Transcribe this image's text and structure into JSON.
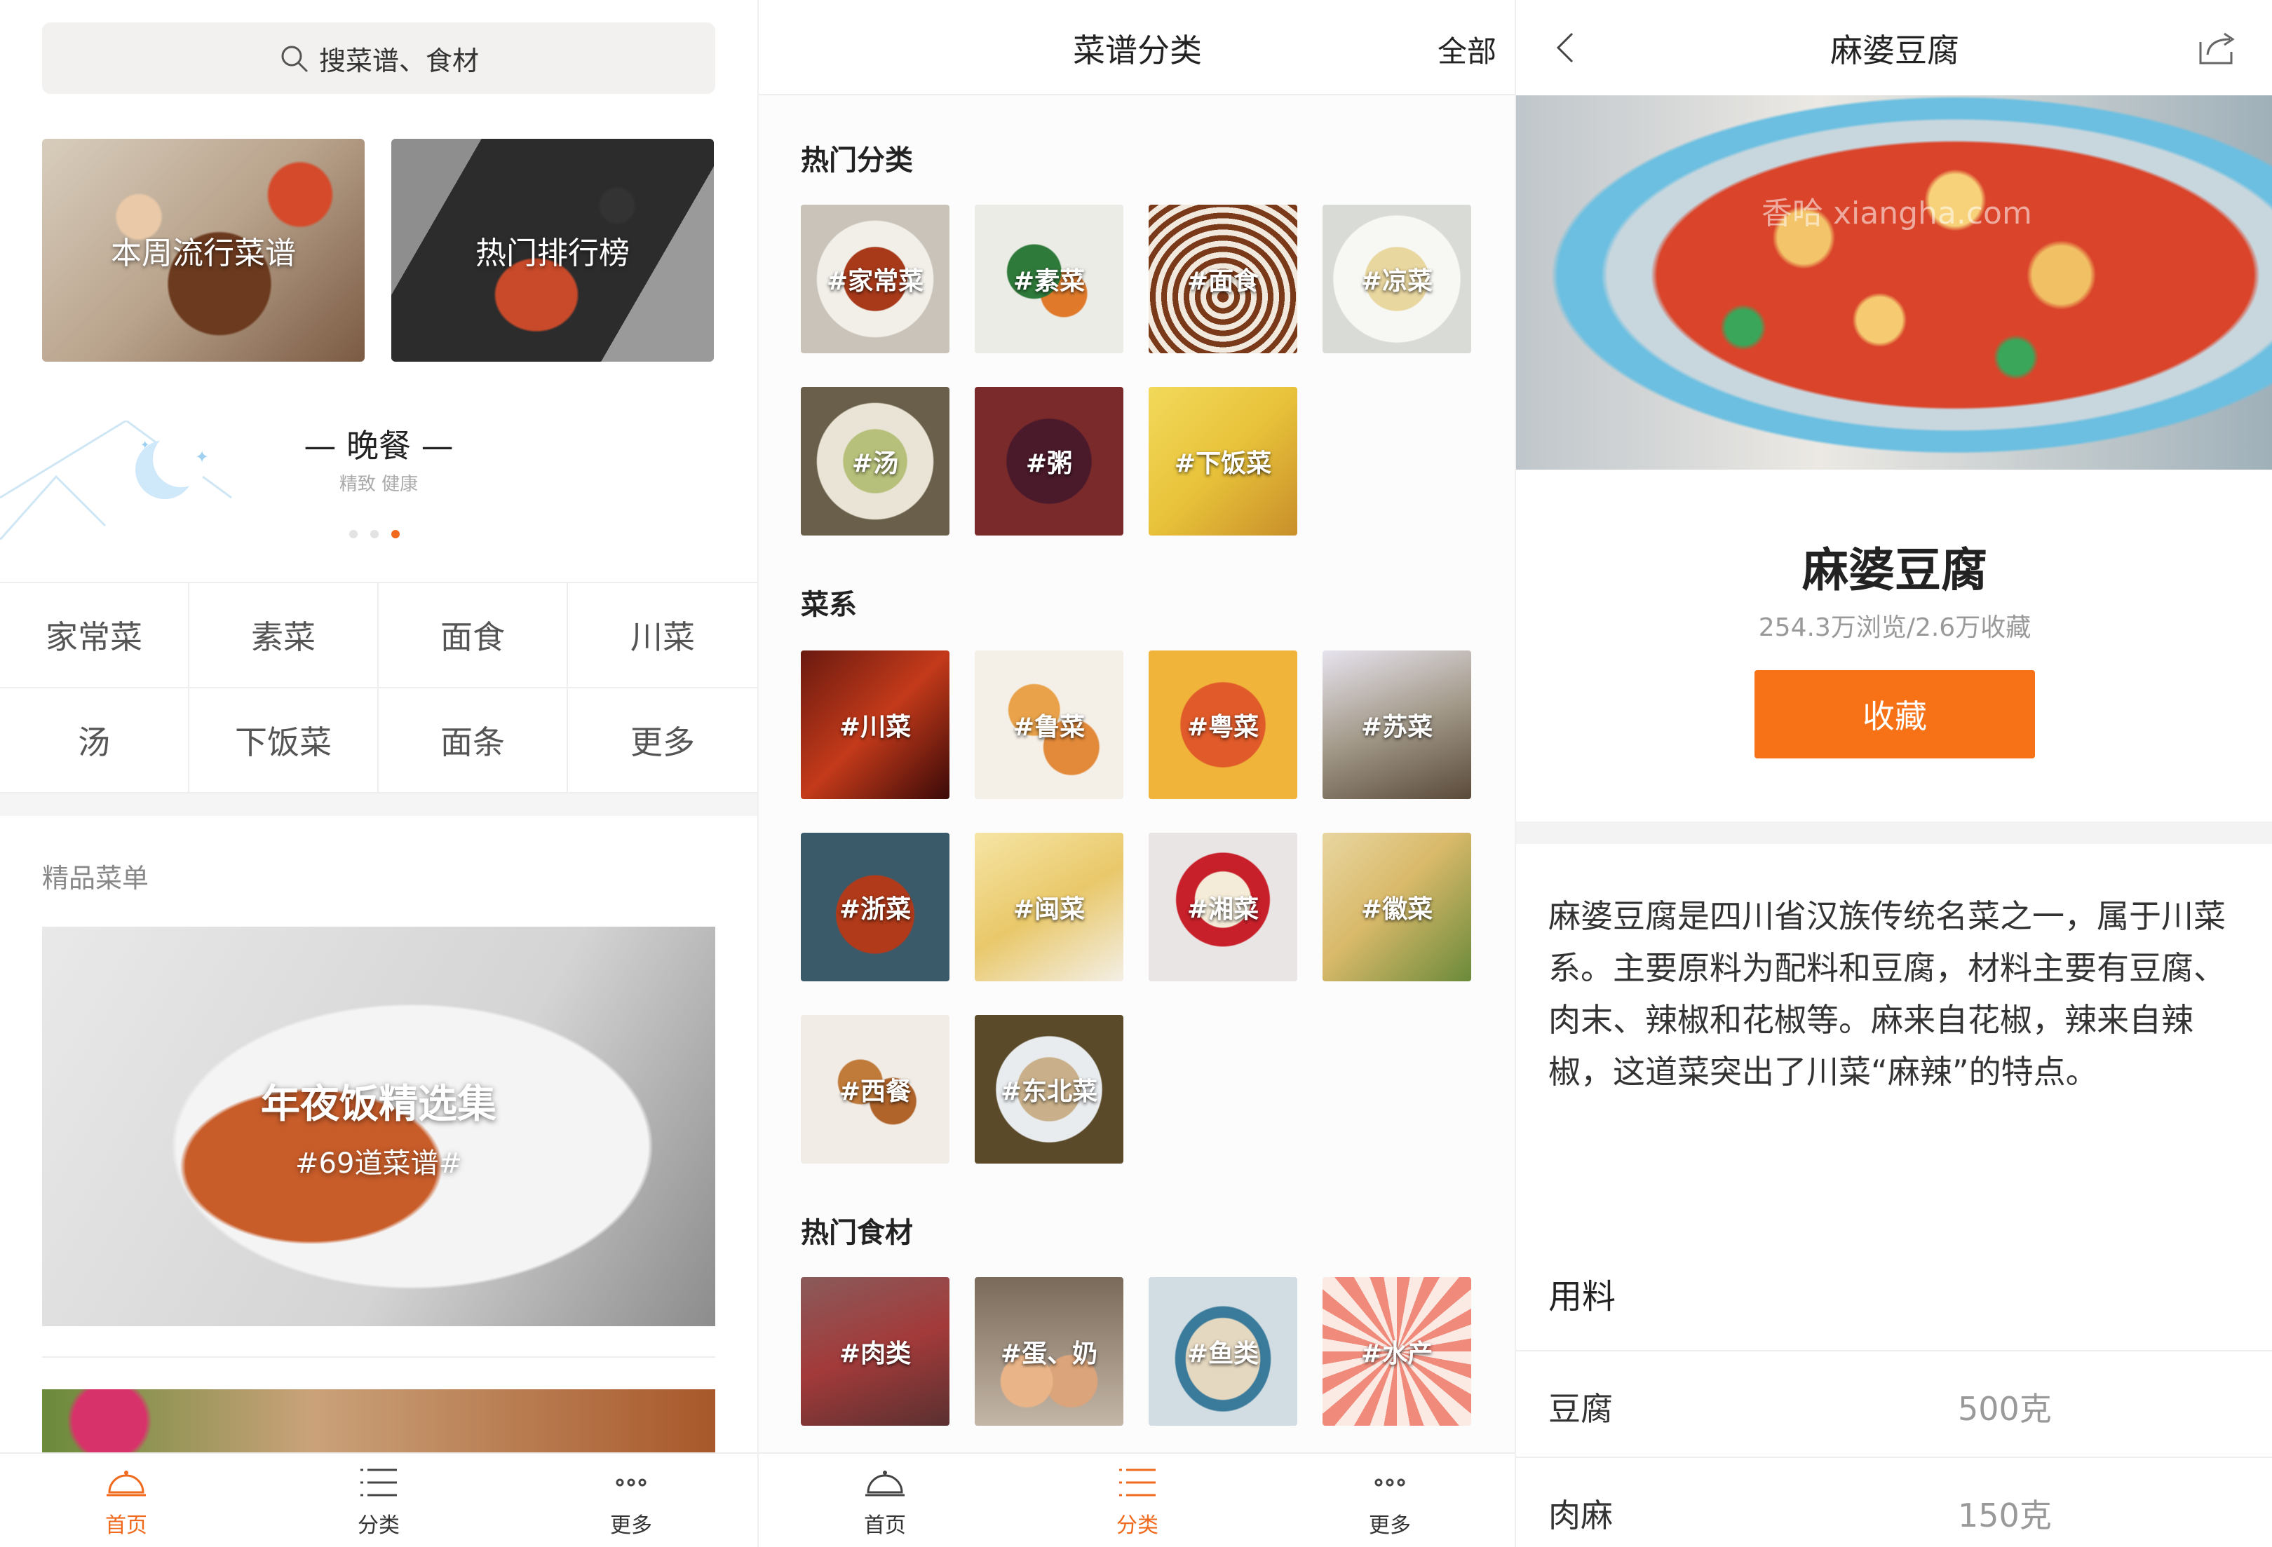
{
  "home": {
    "search_placeholder": "搜菜谱、食材",
    "banners": [
      "本周流行菜谱",
      "热门排行榜"
    ],
    "meal": {
      "title": "— 晚餐 —",
      "subtitle": "精致 健康",
      "page_index": 3,
      "page_count": 3
    },
    "categories": [
      "家常菜",
      "素菜",
      "面食",
      "川菜",
      "汤",
      "下饭菜",
      "面条",
      "更多"
    ],
    "section_label": "精品菜单",
    "feature": {
      "title": "年夜饭精选集",
      "subtitle": "#69道菜谱#"
    },
    "tabs": [
      "首页",
      "分类",
      "更多"
    ],
    "active_tab": "首页"
  },
  "category": {
    "title": "菜谱分类",
    "all_label": "全部",
    "groups": [
      {
        "title": "热门分类",
        "items": [
          "#家常菜",
          "#素菜",
          "#面食",
          "#凉菜",
          "#汤",
          "#粥",
          "#下饭菜"
        ]
      },
      {
        "title": "菜系",
        "items": [
          "#川菜",
          "#鲁菜",
          "#粤菜",
          "#苏菜",
          "#浙菜",
          "#闽菜",
          "#湘菜",
          "#徽菜",
          "#西餐",
          "#东北菜"
        ]
      },
      {
        "title": "热门食材",
        "items": [
          "#肉类",
          "#蛋、奶",
          "#鱼类",
          "#水产"
        ]
      }
    ],
    "tabs": [
      "首页",
      "分类",
      "更多"
    ],
    "active_tab": "分类"
  },
  "detail": {
    "header_title": "麻婆豆腐",
    "watermark": "香哈 xiangha.com",
    "name": "麻婆豆腐",
    "stats": "254.3万浏览/2.6万收藏",
    "favorite_label": "收藏",
    "description": "麻婆豆腐是四川省汉族传统名菜之一，属于川菜系。主要原料为配料和豆腐，材料主要有豆腐、肉末、辣椒和花椒等。麻来自花椒，辣来自辣椒，这道菜突出了川菜“麻辣”的特点。",
    "ingredients_title": "用料",
    "ingredients": [
      {
        "name": "豆腐",
        "qty": "500克"
      },
      {
        "name": "肉麻",
        "qty": "150克"
      }
    ]
  },
  "colors": {
    "accent": "#f06a1d",
    "button": "#f77216"
  },
  "icons": {
    "search": "search-icon",
    "home_tab": "cloche-icon",
    "category_tab": "list-icon",
    "more_tab": "more-dots-icon",
    "back": "chevron-left-icon",
    "share": "share-icon",
    "meal_decoration": "moon-stars-icon"
  }
}
